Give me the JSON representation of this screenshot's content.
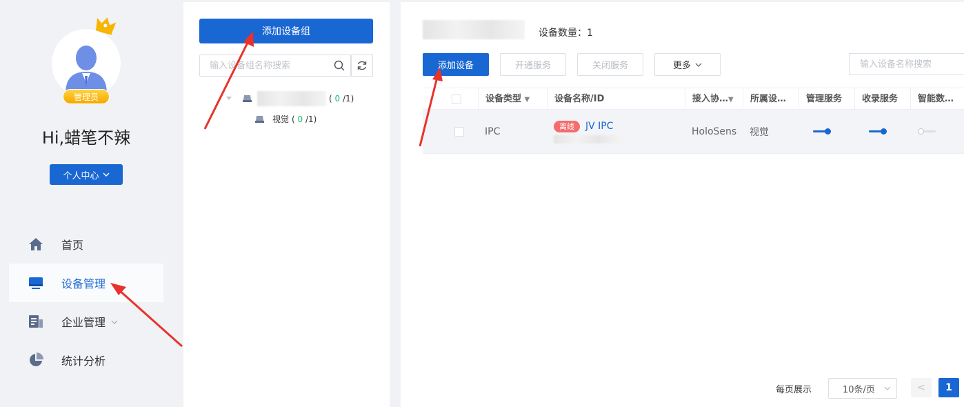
{
  "sidebar": {
    "badge": "管理员",
    "greeting": "Hi,蜡笔不辣",
    "personal_center": "个人中心",
    "nav": [
      {
        "label": "首页",
        "icon": "home-icon"
      },
      {
        "label": "设备管理",
        "icon": "monitor-icon"
      },
      {
        "label": "企业管理",
        "icon": "building-icon"
      },
      {
        "label": "统计分析",
        "icon": "pie-chart-icon"
      }
    ]
  },
  "groups": {
    "add_button": "添加设备组",
    "search_placeholder": "输入设备组名称搜索",
    "tree": {
      "root_count_online": "0",
      "root_count_total": "/1",
      "child_label": "视觉",
      "child_count_online": "0",
      "child_count_total": "/1"
    }
  },
  "main": {
    "device_count": "设备数量：1",
    "buttons": {
      "add_device": "添加设备",
      "enable_service": "开通服务",
      "disable_service": "关闭服务",
      "more": "更多"
    },
    "search_placeholder": "输入设备名称搜索",
    "table": {
      "headers": [
        "设备类型",
        "设备名称/ID",
        "接入协…",
        "所属设…",
        "管理服务",
        "收录服务",
        "智能数…"
      ],
      "rows": [
        {
          "type": "IPC",
          "status": "离线",
          "name": "JV IPC",
          "protocol": "HoloSens",
          "group": "视觉",
          "manage_service": true,
          "record_service": true,
          "smart_data": false
        }
      ]
    },
    "pagination": {
      "label": "每页展示",
      "page_size": "10条/页",
      "prev": "<",
      "current_page": "1"
    }
  },
  "colors": {
    "primary": "#1967d2",
    "offline": "#f56c6c",
    "annotation_arrow": "#e8322b",
    "badge_gold": "#f6a800"
  }
}
